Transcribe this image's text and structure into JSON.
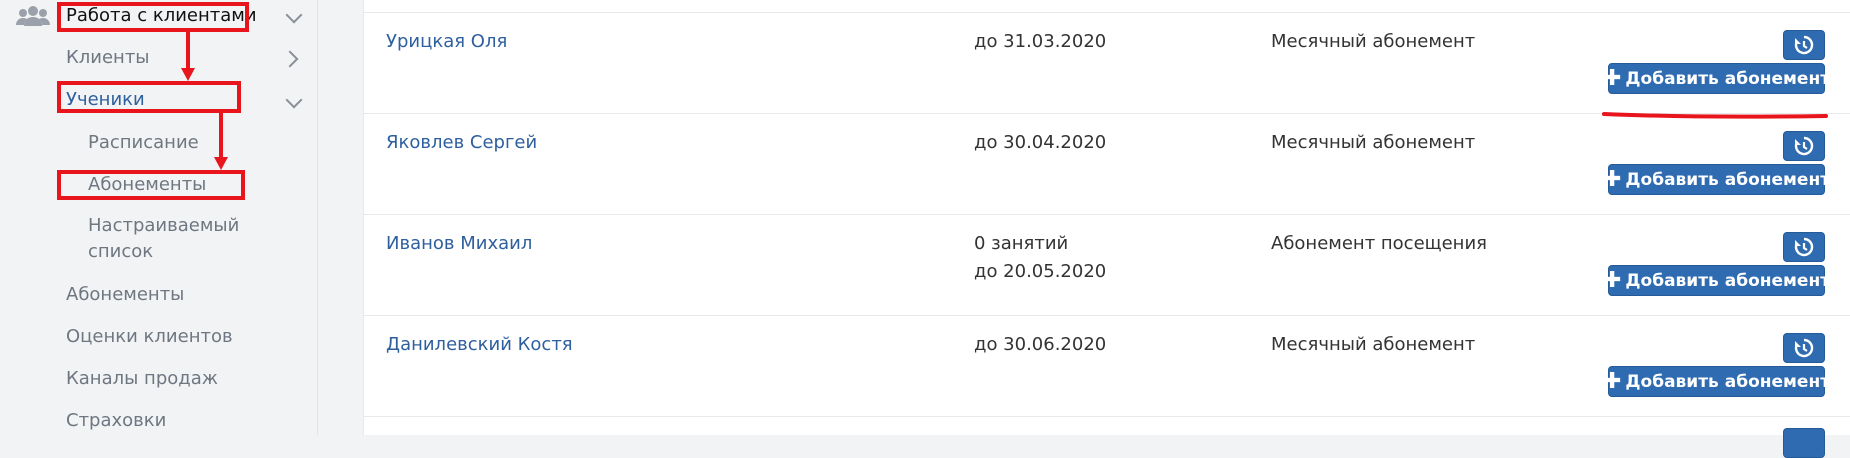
{
  "sidebar": {
    "section_label": "Работа с клиентами",
    "items": [
      {
        "label": "Клиенты"
      },
      {
        "label": "Ученики"
      },
      {
        "label": "Расписание"
      },
      {
        "label": "Абонементы"
      },
      {
        "label": "Настраиваемый"
      },
      {
        "label": "список"
      },
      {
        "label": "Абонементы"
      },
      {
        "label": "Оценки клиентов"
      },
      {
        "label": "Каналы продаж"
      },
      {
        "label": "Страховки"
      }
    ]
  },
  "table": {
    "add_button_label": "Добавить абонемент",
    "history_icon": "history-icon",
    "rows": [
      {
        "name": "Урицкая Оля",
        "line1": "до 31.03.2020",
        "line2": "",
        "type": "Месячный абонемент"
      },
      {
        "name": "Яковлев Сергей",
        "line1": "до 30.04.2020",
        "line2": "",
        "type": "Месячный абонемент"
      },
      {
        "name": "Иванов Михаил",
        "line1": "0 занятий",
        "line2": "до 20.05.2020",
        "type": "Абонемент посещения"
      },
      {
        "name": "Данилевский Костя",
        "line1": "до 30.06.2020",
        "line2": "",
        "type": "Месячный абонемент"
      }
    ]
  },
  "colors": {
    "annotation": "#e8151c",
    "primary_button": "#2f6bb1",
    "link": "#2e5f9e"
  }
}
